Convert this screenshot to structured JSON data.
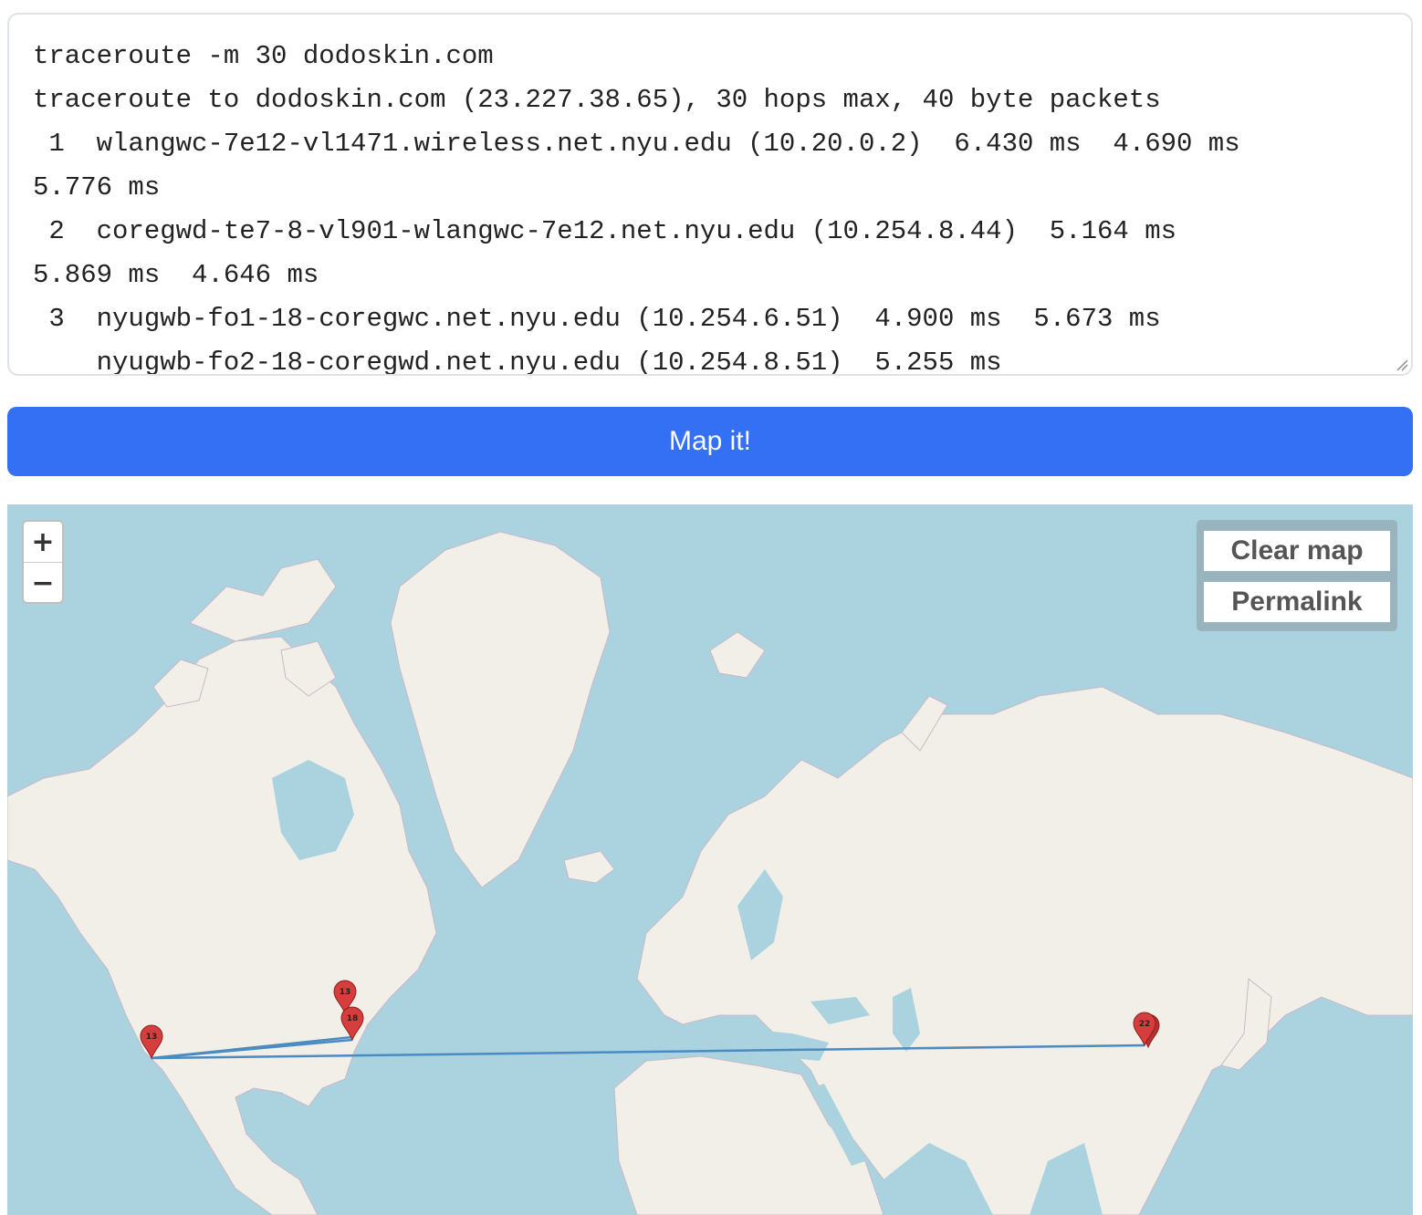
{
  "trace": {
    "lines": [
      "traceroute -m 30 dodoskin.com",
      "traceroute to dodoskin.com (23.227.38.65), 30 hops max, 40 byte packets",
      " 1  wlangwc-7e12-vl1471.wireless.net.nyu.edu (10.20.0.2)  6.430 ms  4.690 ms",
      "5.776 ms",
      " 2  coregwd-te7-8-vl901-wlangwc-7e12.net.nyu.edu (10.254.8.44)  5.164 ms",
      "5.869 ms  4.646 ms",
      " 3  nyugwb-fo1-18-coregwc.net.nyu.edu (10.254.6.51)  4.900 ms  5.673 ms",
      "    nyugwb-fo2-18-coregwd.net.nyu.edu (10.254.8.51)  5.255 ms"
    ]
  },
  "map_button": {
    "label": "Map it!"
  },
  "map": {
    "zoom_in_label": "+",
    "zoom_out_label": "−",
    "clear_label": "Clear map",
    "permalink_label": "Permalink",
    "colors": {
      "water": "#aad3df",
      "land": "#f2efe9",
      "ice": "#ffffff",
      "route": "#4a8bc2",
      "pin": "#d63e3e"
    },
    "markers": [
      {
        "label": "13",
        "place": "San Francisco"
      },
      {
        "label": "13",
        "place": "Toronto"
      },
      {
        "label": "18",
        "place": "New York"
      },
      {
        "label": "22",
        "place": "Shanghai"
      }
    ]
  }
}
